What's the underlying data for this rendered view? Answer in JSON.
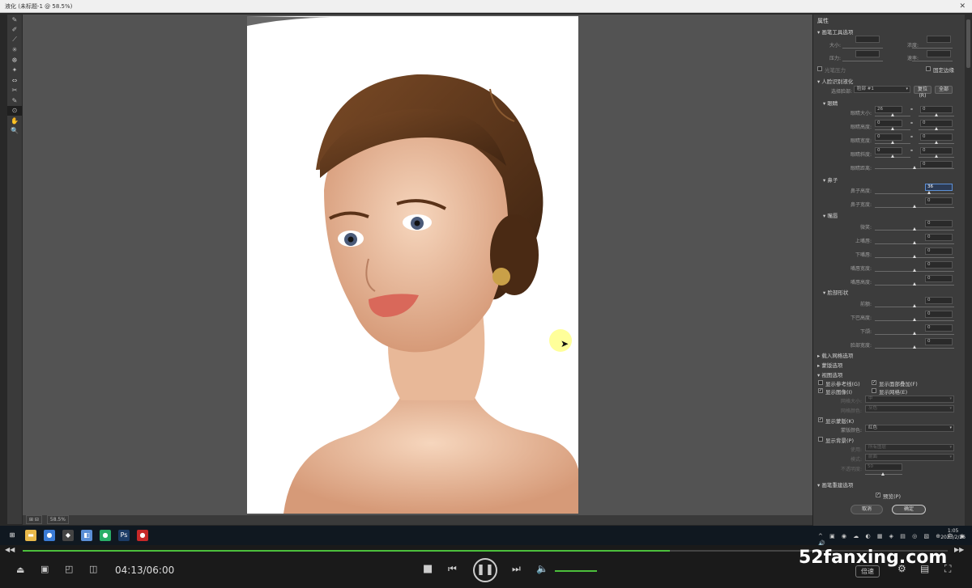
{
  "window": {
    "title": "液化 (未标题-1 @ 58.5%)",
    "close": "✕"
  },
  "toolbar": {
    "tools": [
      "✎",
      "✐",
      "⟋",
      "✳",
      "☸",
      "✦",
      "⇔",
      "✂",
      "✎",
      "⊙",
      "✋",
      "🔍"
    ]
  },
  "status": {
    "zoom": "58.5%",
    "info": "⊞ ⊟"
  },
  "panel": {
    "title": "属性",
    "brush_options": "▾ 画笔工具选项",
    "size_label": "大小:",
    "density_label": "浓度:",
    "pressure_label": "压力:",
    "rate_label": "速率:",
    "stylus_label": "光笔压力",
    "pin_label": "固定边缘",
    "face_section": "▾ 人脸识别液化",
    "select_face_label": "选择脸部:",
    "select_face_value": "脸部 #1",
    "reset_btn": "复位(R)",
    "all_btn": "全部",
    "eyes_section": "▾ 眼睛",
    "eye_rows": [
      {
        "label": "眼睛大小:",
        "left": "26",
        "right": "0"
      },
      {
        "label": "眼睛高度:",
        "left": "0",
        "right": "0"
      },
      {
        "label": "眼睛宽度:",
        "left": "0",
        "right": "0"
      },
      {
        "label": "眼睛斜度:",
        "left": "0",
        "right": "0"
      },
      {
        "label": "眼睛距离:",
        "left": "",
        "right": "0"
      }
    ],
    "nose_section": "▾ 鼻子",
    "nose_rows": [
      {
        "label": "鼻子高度:",
        "value": "36"
      },
      {
        "label": "鼻子宽度:",
        "value": "0"
      }
    ],
    "mouth_section": "▾ 嘴唇",
    "mouth_rows": [
      {
        "label": "微笑:",
        "value": "0"
      },
      {
        "label": "上嘴唇:",
        "value": "0"
      },
      {
        "label": "下嘴唇:",
        "value": "0"
      },
      {
        "label": "嘴唇宽度:",
        "value": "0"
      },
      {
        "label": "嘴唇高度:",
        "value": "0"
      }
    ],
    "face_shape_section": "▾ 脸部形状",
    "face_shape_rows": [
      {
        "label": "前额:",
        "value": "0"
      },
      {
        "label": "下巴高度:",
        "value": "0"
      },
      {
        "label": "下颌:",
        "value": "0"
      },
      {
        "label": "脸部宽度:",
        "value": "0"
      }
    ],
    "load_mesh": "▸ 载入网格选项",
    "mask_options": "▸ 蒙版选项",
    "view_options": "▾ 视图选项",
    "show_guides": "显示参考线(G)",
    "show_face_overlay": "显示面部叠加(F)",
    "show_image": "显示图像(I)",
    "show_mesh": "显示网格(E)",
    "mesh_size_label": "网格大小:",
    "mesh_size_value": "中",
    "mesh_color_label": "网格颜色:",
    "mesh_color_value": "灰色",
    "show_mask": "显示蒙版(K)",
    "mask_color_label": "蒙版颜色:",
    "mask_color_value": "红色",
    "show_backdrop": "显示背景(P)",
    "use_label": "使用:",
    "use_value": "所有图层",
    "mode_label": "模式:",
    "mode_value": "前面",
    "opacity_label": "不透明度:",
    "opacity_value": "50",
    "brush_rebuild": "▾ 画笔重建选项",
    "preview_label": "预览(P)",
    "cancel_btn": "取消",
    "ok_btn": "确定"
  },
  "taskbar": {
    "apps": [
      {
        "name": "start",
        "glyph": "⊞",
        "color": "#101820"
      },
      {
        "name": "explorer",
        "glyph": "▬",
        "color": "#e8b84a"
      },
      {
        "name": "chrome",
        "glyph": "●",
        "color": "#3a7bd5"
      },
      {
        "name": "app3",
        "glyph": "◆",
        "color": "#444"
      },
      {
        "name": "app4",
        "glyph": "◧",
        "color": "#5b8fd6"
      },
      {
        "name": "wechat",
        "glyph": "●",
        "color": "#2aae67"
      },
      {
        "name": "photoshop",
        "glyph": "Ps",
        "color": "#1c3c66"
      },
      {
        "name": "record",
        "glyph": "●",
        "color": "#c62828"
      }
    ],
    "tray_icons": "^ ▣ ◉ ☁ ◐ ▦ ◈ ▤ ◎ ▧ ⊕ 中 ◉ 🔊",
    "time": "1:05",
    "date": "2023/2/26"
  },
  "player": {
    "time_display": "04:13/06:00",
    "progress": 0.7,
    "speed_label": "倍速",
    "watermark": "52fanxing.com"
  }
}
